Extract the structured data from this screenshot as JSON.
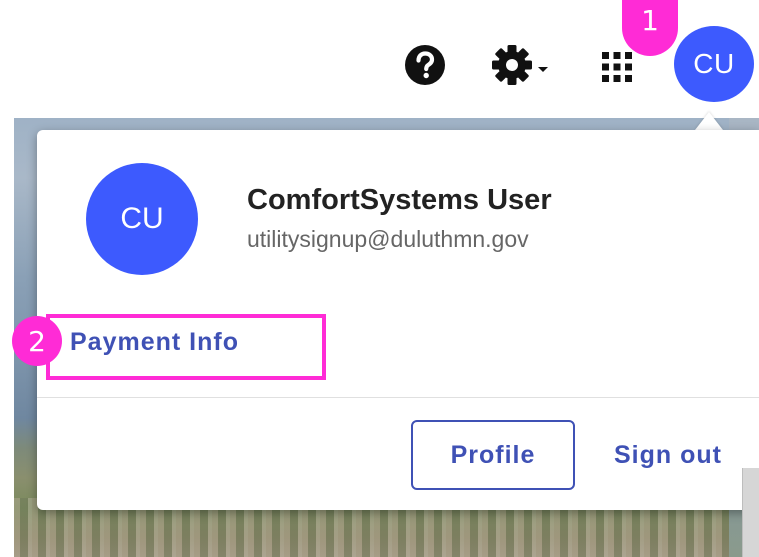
{
  "toolbar": {
    "help_icon": "help-circle-icon",
    "settings_icon": "gear-icon",
    "settings_caret_icon": "caret-down-icon",
    "apps_icon": "apps-grid-icon",
    "avatar_initials": "CU"
  },
  "markers": {
    "step1": "1",
    "step2": "2",
    "color": "#ff2bd6"
  },
  "account_menu": {
    "avatar_initials": "CU",
    "user_name": "ComfortSystems User",
    "user_email": "utilitysignup@duluthmn.gov",
    "payment_info_label": "Payment Info",
    "profile_label": "Profile",
    "sign_out_label": "Sign out"
  },
  "colors": {
    "avatar": "#3d5afe",
    "accent": "#3f51b5",
    "highlight": "#ff2bd6"
  }
}
